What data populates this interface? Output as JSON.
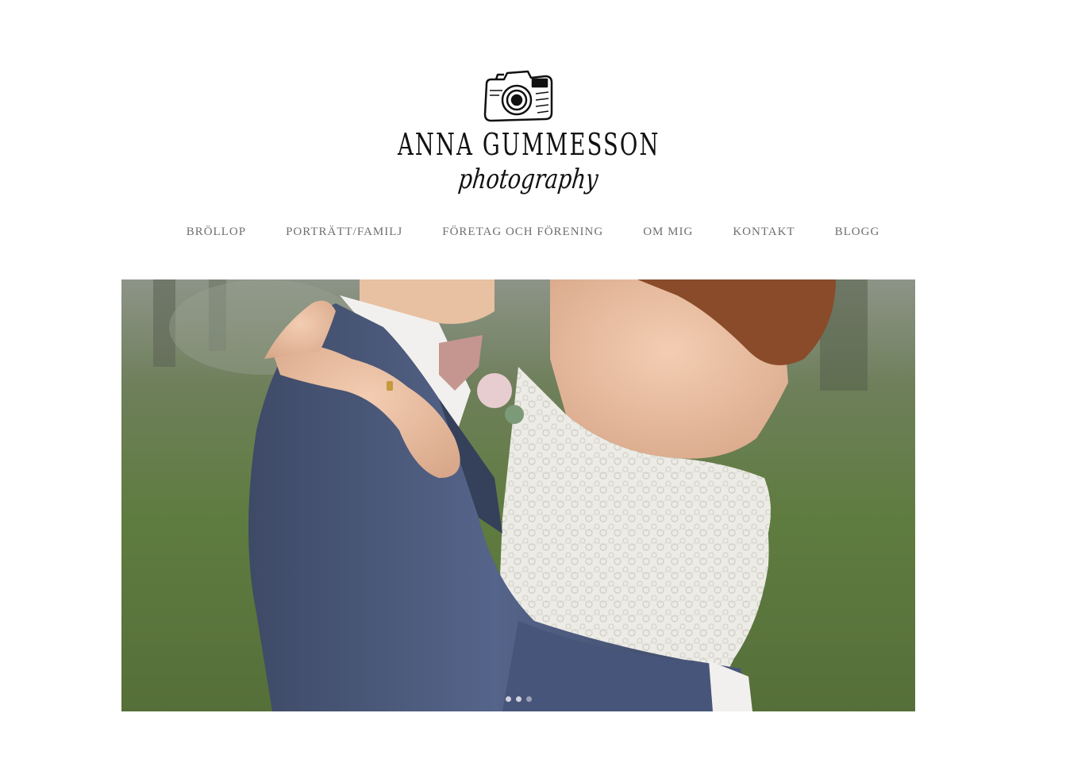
{
  "brand": {
    "name": "ANNA GUMMESSON",
    "tagline": "photography",
    "logo_icon": "camera-icon"
  },
  "nav": {
    "items": [
      {
        "label": "BRÖLLOP"
      },
      {
        "label": "PORTRÄTT/FAMILJ"
      },
      {
        "label": "FÖRETAG OCH FÖRENING"
      },
      {
        "label": "OM MIG"
      },
      {
        "label": "KONTAKT"
      },
      {
        "label": "BLOGG"
      }
    ]
  },
  "hero": {
    "slide_count": 3,
    "active_slide": 1
  },
  "colors": {
    "nav_text": "#6f6f6f",
    "background": "#ffffff",
    "suit": "#4a5778",
    "grass": "#5e7a3f",
    "dress": "#efeeea"
  }
}
